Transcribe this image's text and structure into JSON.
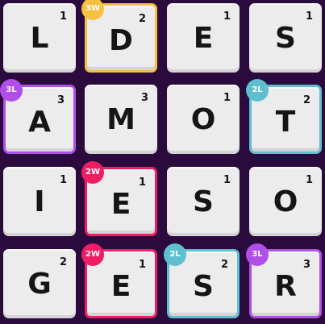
{
  "colors": {
    "background": "#2b0a3d",
    "tile": "#ececec",
    "bonus_3w": "#f6c142",
    "bonus_3l": "#b04ee8",
    "bonus_2l": "#5fbfcf",
    "bonus_2w": "#ef1e64"
  },
  "grid": [
    [
      {
        "letter": "L",
        "points": "1",
        "bonus": ""
      },
      {
        "letter": "D",
        "points": "2",
        "bonus": "3W"
      },
      {
        "letter": "E",
        "points": "1",
        "bonus": ""
      },
      {
        "letter": "S",
        "points": "1",
        "bonus": ""
      }
    ],
    [
      {
        "letter": "A",
        "points": "3",
        "bonus": "3L"
      },
      {
        "letter": "M",
        "points": "3",
        "bonus": ""
      },
      {
        "letter": "O",
        "points": "1",
        "bonus": ""
      },
      {
        "letter": "T",
        "points": "2",
        "bonus": "2L"
      }
    ],
    [
      {
        "letter": "I",
        "points": "1",
        "bonus": ""
      },
      {
        "letter": "E",
        "points": "1",
        "bonus": "2W"
      },
      {
        "letter": "S",
        "points": "1",
        "bonus": ""
      },
      {
        "letter": "O",
        "points": "1",
        "bonus": ""
      }
    ],
    [
      {
        "letter": "G",
        "points": "2",
        "bonus": ""
      },
      {
        "letter": "E",
        "points": "1",
        "bonus": "2W"
      },
      {
        "letter": "S",
        "points": "2",
        "bonus": "2L"
      },
      {
        "letter": "R",
        "points": "3",
        "bonus": "3L"
      }
    ]
  ]
}
